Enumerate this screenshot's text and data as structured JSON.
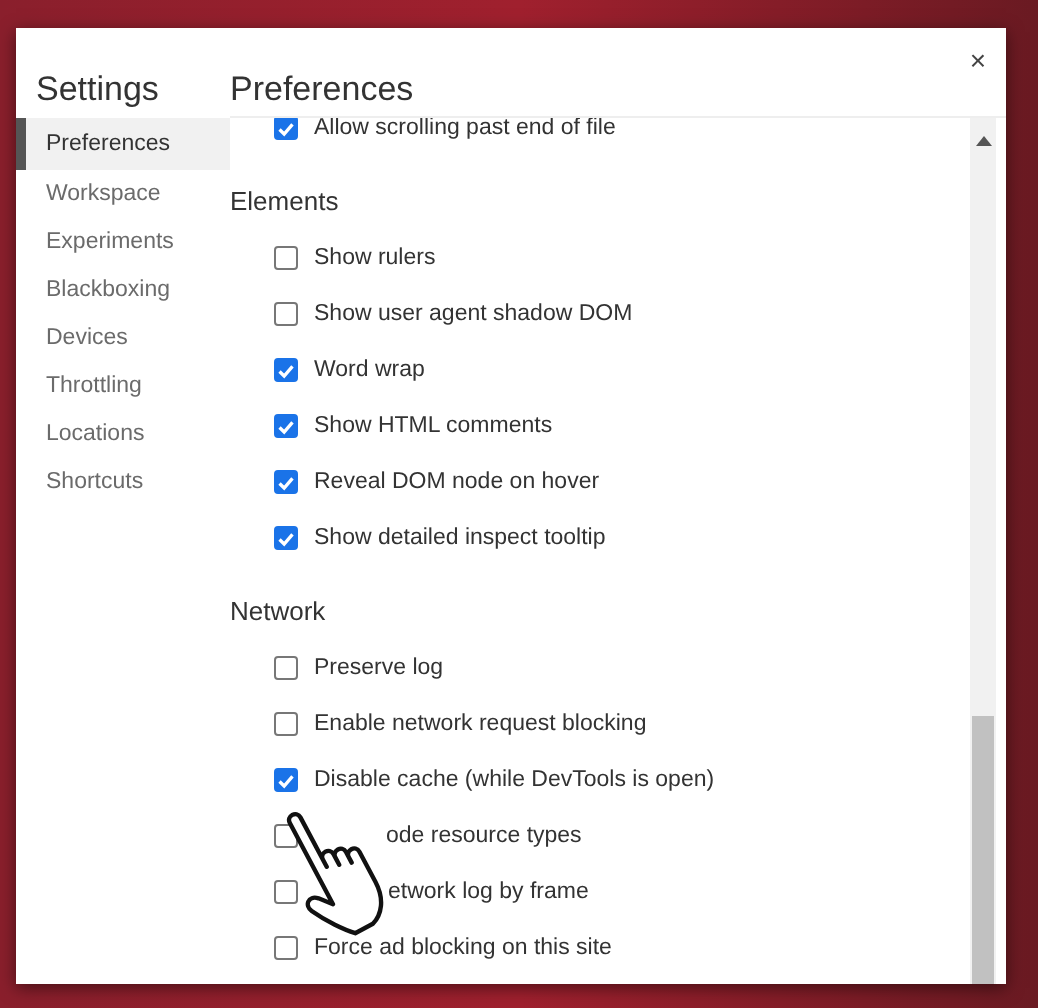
{
  "dialog": {
    "close": "×"
  },
  "sidebar": {
    "title": "Settings",
    "items": [
      {
        "label": "Preferences",
        "selected": true
      },
      {
        "label": "Workspace",
        "selected": false
      },
      {
        "label": "Experiments",
        "selected": false
      },
      {
        "label": "Blackboxing",
        "selected": false
      },
      {
        "label": "Devices",
        "selected": false
      },
      {
        "label": "Throttling",
        "selected": false
      },
      {
        "label": "Locations",
        "selected": false
      },
      {
        "label": "Shortcuts",
        "selected": false
      }
    ]
  },
  "main": {
    "title": "Preferences",
    "sections": [
      {
        "items": [
          {
            "kind": "cut",
            "label": "Allow scrolling past end of file",
            "checked": true
          }
        ]
      },
      {
        "title": "Elements",
        "items": [
          {
            "kind": "checkbox",
            "label": "Show rulers",
            "checked": false
          },
          {
            "kind": "checkbox",
            "label": "Show user agent shadow DOM",
            "checked": false
          },
          {
            "kind": "checkbox",
            "label": "Word wrap",
            "checked": true
          },
          {
            "kind": "checkbox",
            "label": "Show HTML comments",
            "checked": true
          },
          {
            "kind": "checkbox",
            "label": "Reveal DOM node on hover",
            "checked": true
          },
          {
            "kind": "checkbox",
            "label": "Show detailed inspect tooltip",
            "checked": true
          }
        ]
      },
      {
        "title": "Network",
        "items": [
          {
            "kind": "checkbox",
            "label": "Preserve log",
            "checked": false
          },
          {
            "kind": "checkbox",
            "label": "Enable network request blocking",
            "checked": false
          },
          {
            "kind": "checkbox",
            "label": "Disable cache (while DevTools is open)",
            "checked": true
          },
          {
            "kind": "covered",
            "label": "ode resource types",
            "checked": false
          },
          {
            "kind": "covered2",
            "label": "etwork log by frame",
            "checked": false
          },
          {
            "kind": "checkbox",
            "label": "Force ad blocking on this site",
            "checked": false
          }
        ]
      }
    ]
  }
}
